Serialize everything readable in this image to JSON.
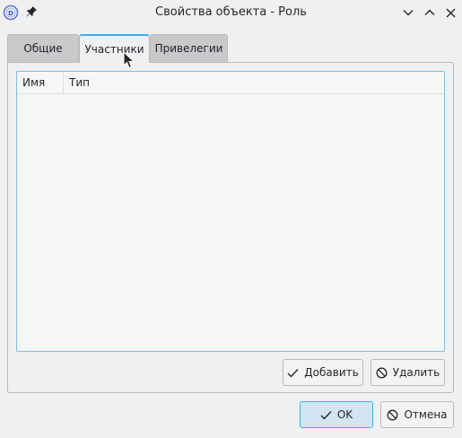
{
  "window": {
    "title": "Свойства объекта - Роль",
    "icons": {
      "app": "dbeaver-app-icon",
      "pin": "pin-icon",
      "minimize": "chevron-down-icon",
      "maximize": "chevron-up-icon",
      "close": "close-icon"
    }
  },
  "tabs": [
    {
      "label": "Общие",
      "active": false
    },
    {
      "label": "Участники",
      "active": true
    },
    {
      "label": "Привелегии",
      "active": false
    }
  ],
  "table": {
    "columns": [
      "Имя",
      "Тип"
    ],
    "rows": []
  },
  "panel_buttons": {
    "add_label": "Добавить",
    "delete_label": "Удалить"
  },
  "dialog_buttons": {
    "ok_label": "OK",
    "cancel_label": "Отмена"
  },
  "colors": {
    "accent": "#3daee9",
    "window_bg": "#eff0f1",
    "ok_bg": "#d2e5f1"
  }
}
